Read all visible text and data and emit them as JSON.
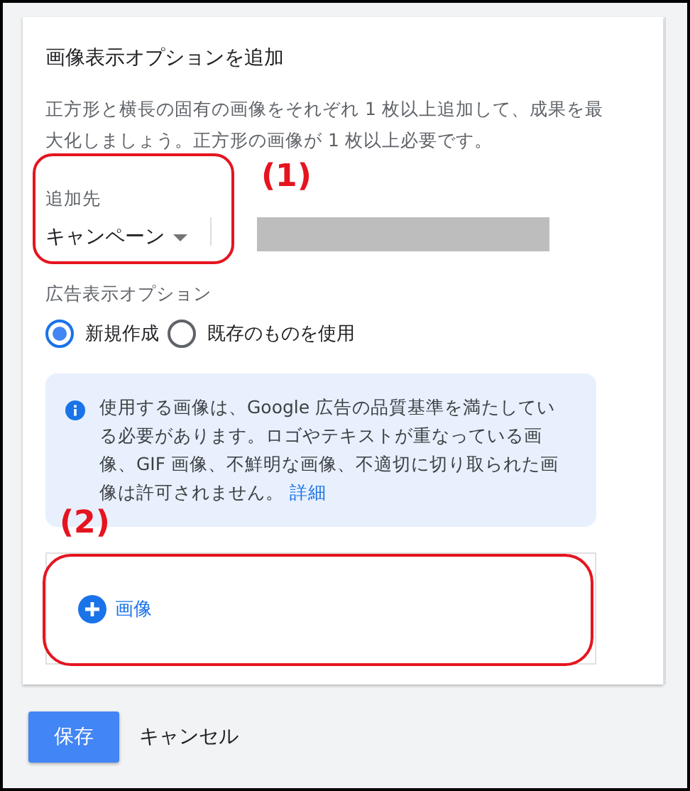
{
  "dialog": {
    "title": "画像表示オプションを追加",
    "description": "正方形と横長の固有の画像をそれぞれ 1 枚以上追加して、成果を最大化しましょう。正方形の画像が 1 枚以上必要です。",
    "target": {
      "label": "追加先",
      "value": "キャンペーン"
    },
    "ad_option": {
      "label": "広告表示オプション",
      "options": [
        {
          "label": "新規作成",
          "selected": true
        },
        {
          "label": "既存のものを使用",
          "selected": false
        }
      ]
    },
    "info": {
      "text": "使用する画像は、Google 広告の品質基準を満たしている必要があります。ロゴやテキストが重なっている画像、GIF 画像、不鮮明な画像、不適切に切り取られた画像は許可されません。",
      "link": "詳細"
    },
    "add_image": {
      "label": "画像"
    }
  },
  "footer": {
    "buttons": [
      {
        "label": "保存",
        "kind": "primary"
      },
      {
        "label": "キャンセル",
        "kind": "text"
      }
    ]
  },
  "annotations": [
    {
      "label": "(1)"
    },
    {
      "label": "(2)"
    }
  ]
}
